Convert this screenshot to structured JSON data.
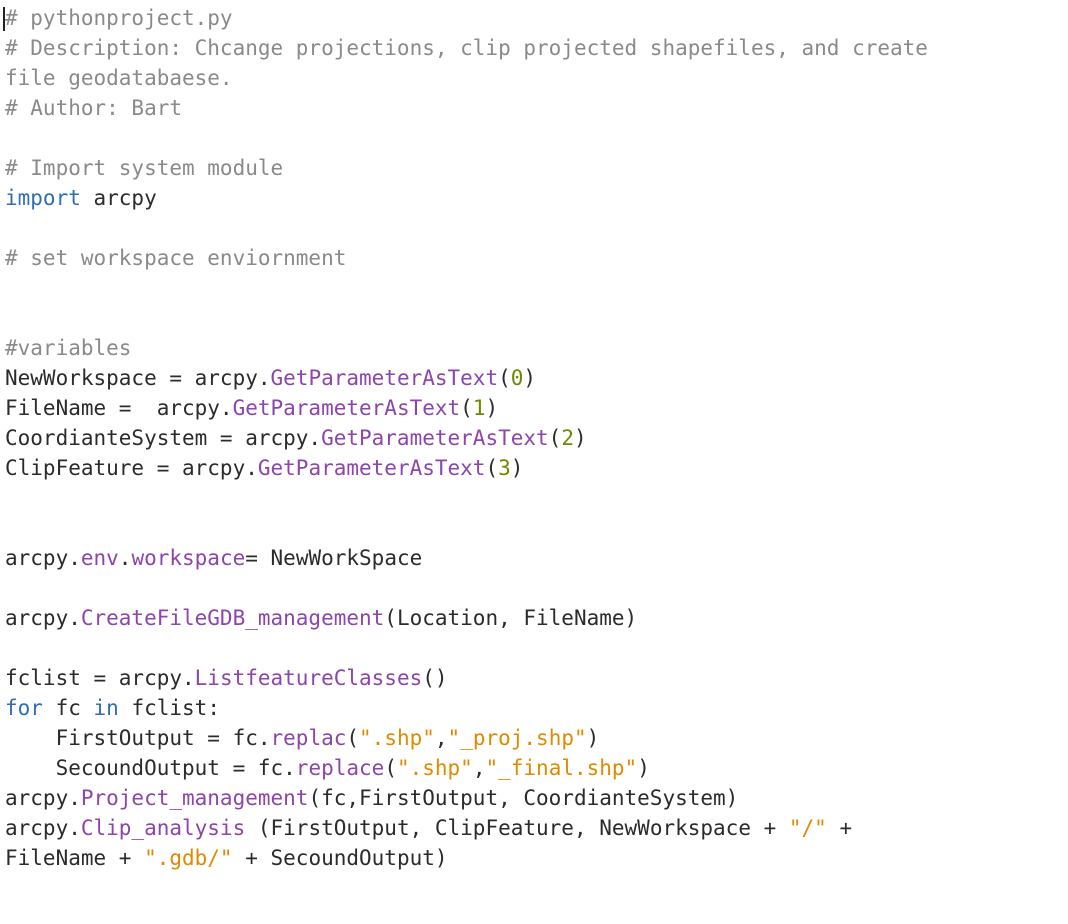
{
  "editor": {
    "file_title": "pythonproject.py",
    "lines": [
      [
        {
          "t": "# pythonproject.py",
          "c": "c"
        }
      ],
      [
        {
          "t": "# Description: Chcange projections, clip projected shapefiles, and create",
          "c": "c"
        }
      ],
      [
        {
          "t": "file geodatabaese.",
          "c": "c"
        }
      ],
      [
        {
          "t": "# Author: Bart",
          "c": "c"
        }
      ],
      [],
      [
        {
          "t": "# Import system module",
          "c": "c"
        }
      ],
      [
        {
          "t": "import",
          "c": "k"
        },
        {
          "t": " arcpy",
          "c": "t"
        }
      ],
      [],
      [
        {
          "t": "# set workspace enviornment",
          "c": "c"
        }
      ],
      [],
      [],
      [
        {
          "t": "#variables",
          "c": "c"
        }
      ],
      [
        {
          "t": "NewWorkspace = arcpy.",
          "c": "t"
        },
        {
          "t": "GetParameterAsText",
          "c": "f"
        },
        {
          "t": "(",
          "c": "t"
        },
        {
          "t": "0",
          "c": "n"
        },
        {
          "t": ")",
          "c": "t"
        }
      ],
      [
        {
          "t": "FileName =  arcpy.",
          "c": "t"
        },
        {
          "t": "GetParameterAsText",
          "c": "f"
        },
        {
          "t": "(",
          "c": "t"
        },
        {
          "t": "1",
          "c": "n"
        },
        {
          "t": ")",
          "c": "t"
        }
      ],
      [
        {
          "t": "CoordianteSystem = arcpy.",
          "c": "t"
        },
        {
          "t": "GetParameterAsText",
          "c": "f"
        },
        {
          "t": "(",
          "c": "t"
        },
        {
          "t": "2",
          "c": "n"
        },
        {
          "t": ")",
          "c": "t"
        }
      ],
      [
        {
          "t": "ClipFeature = arcpy.",
          "c": "t"
        },
        {
          "t": "GetParameterAsText",
          "c": "f"
        },
        {
          "t": "(",
          "c": "t"
        },
        {
          "t": "3",
          "c": "n"
        },
        {
          "t": ")",
          "c": "t"
        }
      ],
      [],
      [],
      [
        {
          "t": "arcpy.",
          "c": "t"
        },
        {
          "t": "env",
          "c": "f"
        },
        {
          "t": ".",
          "c": "t"
        },
        {
          "t": "workspace",
          "c": "f"
        },
        {
          "t": "= NewWorkSpace",
          "c": "t"
        }
      ],
      [],
      [
        {
          "t": "arcpy.",
          "c": "t"
        },
        {
          "t": "CreateFileGDB_management",
          "c": "f"
        },
        {
          "t": "(Location, FileName)",
          "c": "t"
        }
      ],
      [],
      [
        {
          "t": "fclist = arcpy.",
          "c": "t"
        },
        {
          "t": "ListfeatureClasses",
          "c": "f"
        },
        {
          "t": "()",
          "c": "t"
        }
      ],
      [
        {
          "t": "for",
          "c": "k"
        },
        {
          "t": " fc ",
          "c": "t"
        },
        {
          "t": "in",
          "c": "k"
        },
        {
          "t": " fclist:",
          "c": "t"
        }
      ],
      [
        {
          "t": "    FirstOutput = fc.",
          "c": "t"
        },
        {
          "t": "replac",
          "c": "f"
        },
        {
          "t": "(",
          "c": "t"
        },
        {
          "t": "\".shp\"",
          "c": "s"
        },
        {
          "t": ",",
          "c": "t"
        },
        {
          "t": "\"_proj.shp\"",
          "c": "s"
        },
        {
          "t": ")",
          "c": "t"
        }
      ],
      [
        {
          "t": "    SecoundOutput = fc.",
          "c": "t"
        },
        {
          "t": "replace",
          "c": "f"
        },
        {
          "t": "(",
          "c": "t"
        },
        {
          "t": "\".shp\"",
          "c": "s"
        },
        {
          "t": ",",
          "c": "t"
        },
        {
          "t": "\"_final.shp\"",
          "c": "s"
        },
        {
          "t": ")",
          "c": "t"
        }
      ],
      [
        {
          "t": "arcpy.",
          "c": "t"
        },
        {
          "t": "Project_management",
          "c": "f"
        },
        {
          "t": "(fc,FirstOutput, CoordianteSystem)",
          "c": "t"
        }
      ],
      [
        {
          "t": "arcpy.",
          "c": "t"
        },
        {
          "t": "Clip_analysis",
          "c": "f"
        },
        {
          "t": " (FirstOutput, ClipFeature, NewWorkspace + ",
          "c": "t"
        },
        {
          "t": "\"/\"",
          "c": "s"
        },
        {
          "t": " +",
          "c": "t"
        }
      ],
      [
        {
          "t": "FileName + ",
          "c": "t"
        },
        {
          "t": "\".gdb/\"",
          "c": "s"
        },
        {
          "t": " + SecoundOutput)",
          "c": "t"
        }
      ]
    ]
  },
  "colors": {
    "comment": "#8a8a8a",
    "keyword": "#2f6fb0",
    "function": "#8e44ad",
    "string": "#e08a00",
    "number": "#6a8a00",
    "text": "#2b2b2b",
    "background": "#ffffff"
  }
}
